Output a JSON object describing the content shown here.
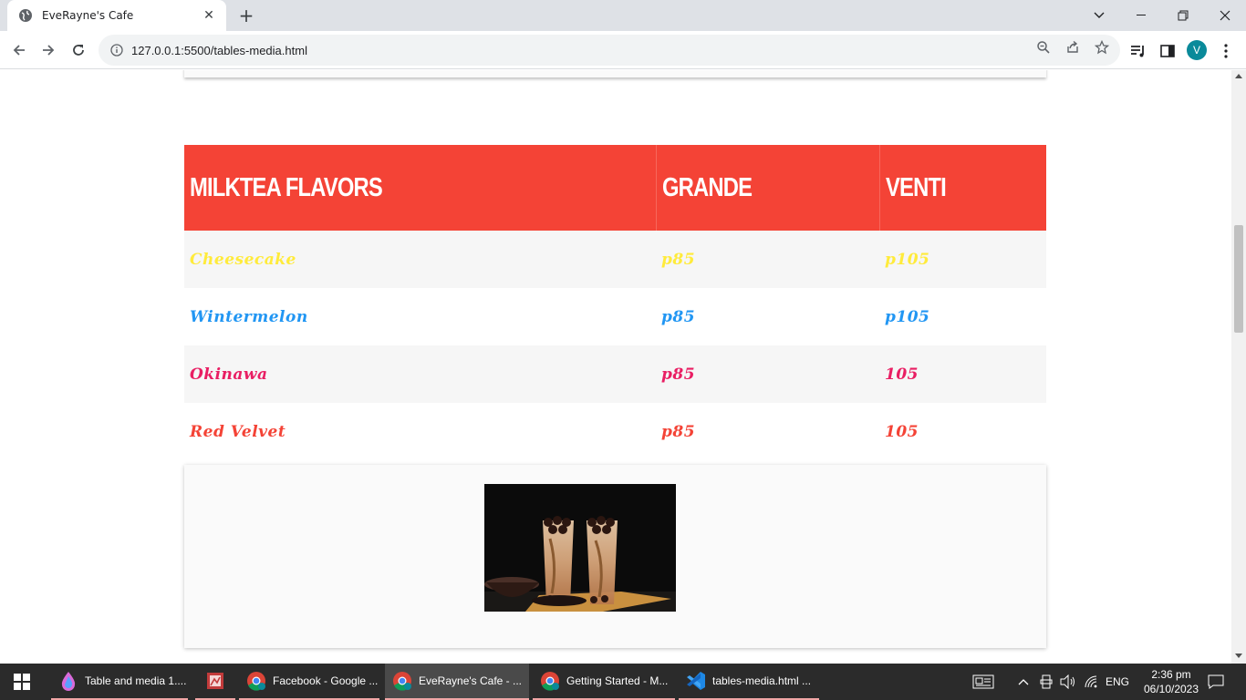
{
  "browser": {
    "tab_title": "EveRayne's Cafe",
    "url": "127.0.0.1:5500/tables-media.html",
    "avatar_letter": "V"
  },
  "page": {
    "table": {
      "headers": [
        "MILKTEA FLAVORS",
        "GRANDE",
        "VENTI"
      ],
      "header_color": "#f44336",
      "rows": [
        {
          "flavor": "Cheesecake",
          "grande": "p85",
          "venti": "p105",
          "color": "#ffeb3b"
        },
        {
          "flavor": "Wintermelon",
          "grande": "p85",
          "venti": "p105",
          "color": "#2196f3"
        },
        {
          "flavor": "Okinawa",
          "grande": "p85",
          "venti": "105",
          "color": "#e91e63"
        },
        {
          "flavor": "Red Velvet",
          "grande": "p85",
          "venti": "105",
          "color": "#f44336"
        }
      ]
    },
    "media": {
      "image_alt": "milk tea photo"
    }
  },
  "taskbar": {
    "items": [
      {
        "label": "Table and media 1...."
      },
      {
        "label": ""
      },
      {
        "label": "Facebook - Google ..."
      },
      {
        "label": "EveRayne's Cafe - ..."
      },
      {
        "label": "Getting Started - M..."
      },
      {
        "label": "tables-media.html ..."
      }
    ],
    "language": "ENG",
    "time": "2:36 pm",
    "date": "06/10/2023"
  }
}
